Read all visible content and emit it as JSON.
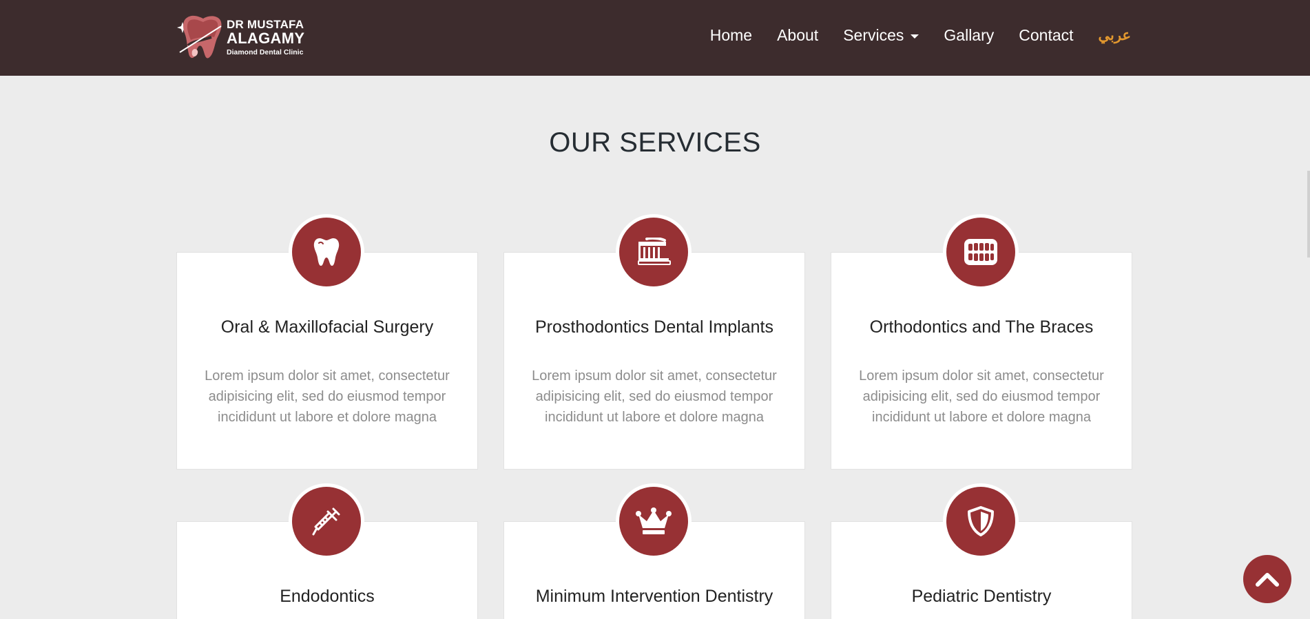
{
  "header": {
    "brand": {
      "line1": "DR MUSTAFA",
      "line2": "ALAGAMY",
      "line3": "Diamond Dental Clinic"
    },
    "nav": [
      {
        "label": "Home"
      },
      {
        "label": "About"
      },
      {
        "label": "Services",
        "has_dropdown": true
      },
      {
        "label": "Gallary"
      },
      {
        "label": "Contact"
      },
      {
        "label": "عربي",
        "color": "#e3982e"
      }
    ]
  },
  "services": {
    "title": "OUR SERVICES",
    "items": [
      {
        "title": "Oral & Maxillofacial Surgery",
        "icon": "tooth-icon",
        "description": "Lorem ipsum dolor sit amet, consectetur adipisicing elit, sed do eiusmod tempor incididunt ut labore et dolore magna"
      },
      {
        "title": "Prosthodontics Dental Implants",
        "icon": "toothbrush-icon",
        "description": "Lorem ipsum dolor sit amet, consectetur adipisicing elit, sed do eiusmod tempor incididunt ut labore et dolore magna"
      },
      {
        "title": "Orthodontics and The Braces",
        "icon": "teeth-icon",
        "description": "Lorem ipsum dolor sit amet, consectetur adipisicing elit, sed do eiusmod tempor incididunt ut labore et dolore magna"
      },
      {
        "title": "Endodontics",
        "icon": "syringe-icon"
      },
      {
        "title": "Minimum Intervention Dentistry",
        "icon": "crown-icon"
      },
      {
        "title": "Pediatric Dentistry",
        "icon": "shield-icon"
      }
    ]
  },
  "colors": {
    "navbar_bg": "#3d2c2d",
    "accent": "#973134",
    "arabic_link": "#e3982e",
    "page_bg": "#ececec"
  },
  "scroll_top": {
    "icon": "chevron-up-icon"
  }
}
